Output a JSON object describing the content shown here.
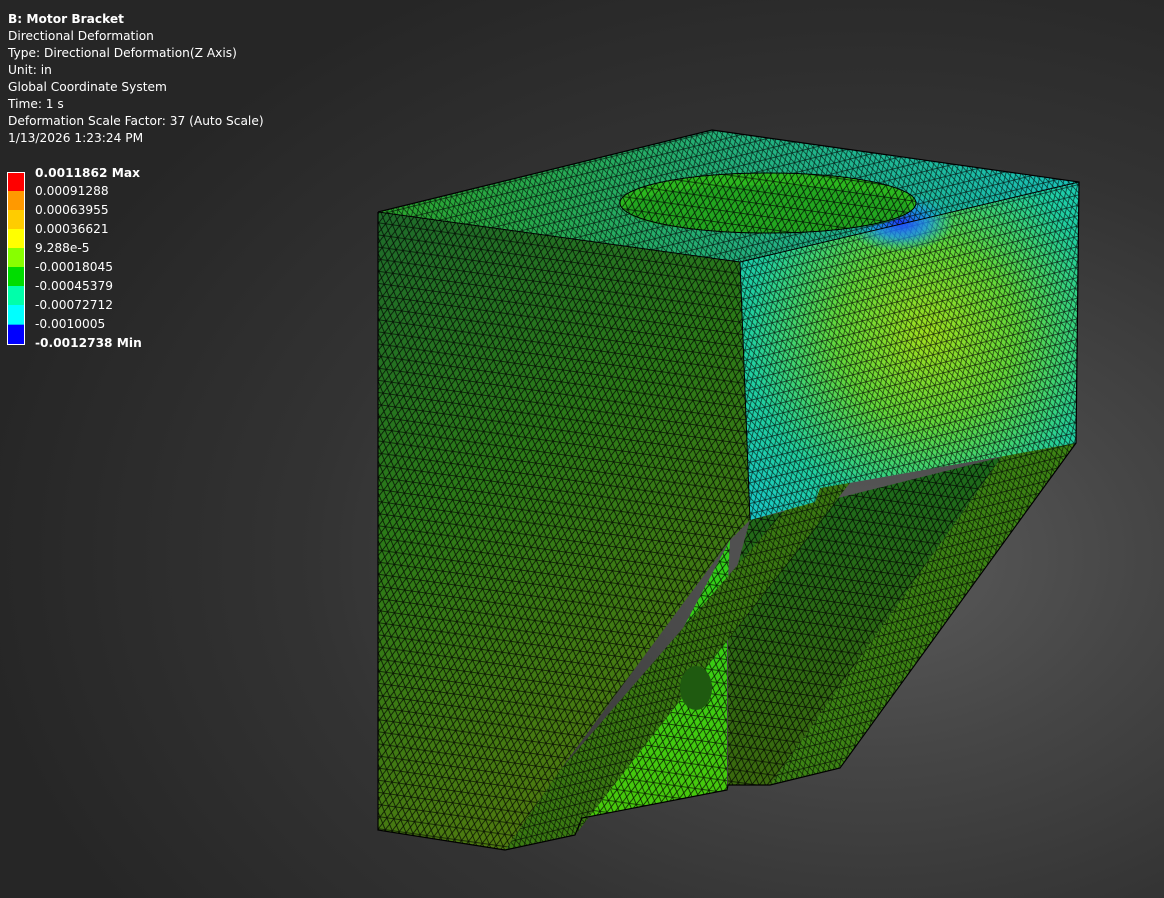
{
  "info": {
    "title": "B: Motor Bracket",
    "result_name": "Directional Deformation",
    "type": "Type: Directional Deformation(Z Axis)",
    "unit": "Unit: in",
    "coord_system": "Global Coordinate System",
    "time": "Time: 1 s",
    "scale_factor": "Deformation Scale Factor: 37 (Auto Scale)",
    "timestamp": "1/13/2026 1:23:24 PM"
  },
  "legend": {
    "labels": [
      "0.0011862 Max",
      "0.00091288",
      "0.00063955",
      "0.00036621",
      "9.288e-5",
      "-0.00018045",
      "-0.00045379",
      "-0.00072712",
      "-0.0010005",
      "-0.0012738 Min"
    ],
    "colors": [
      "#ff0000",
      "#ff9900",
      "#ffcc00",
      "#ffff00",
      "#88ff00",
      "#00dd00",
      "#00ffaa",
      "#00ffff",
      "#00aaff",
      "#0000ff"
    ]
  }
}
